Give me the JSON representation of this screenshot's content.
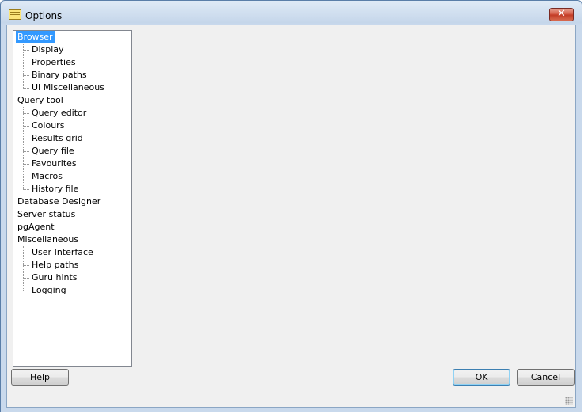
{
  "window": {
    "title": "Options"
  },
  "tree": {
    "groups": [
      {
        "label": "Browser",
        "selected": true,
        "children": [
          "Display",
          "Properties",
          "Binary paths",
          "UI Miscellaneous"
        ]
      },
      {
        "label": "Query tool",
        "children": [
          "Query editor",
          "Colours",
          "Results grid",
          "Query file",
          "Favourites",
          "Macros",
          "History file"
        ]
      },
      {
        "label": "Database Designer",
        "children": []
      },
      {
        "label": "Server status",
        "children": []
      },
      {
        "label": "pgAgent",
        "children": []
      },
      {
        "label": "Miscellaneous",
        "children": [
          "User Interface",
          "Help paths",
          "Guru hints",
          "Logging"
        ]
      }
    ]
  },
  "buttons": {
    "help": "Help",
    "ok": "OK",
    "cancel": "Cancel"
  }
}
